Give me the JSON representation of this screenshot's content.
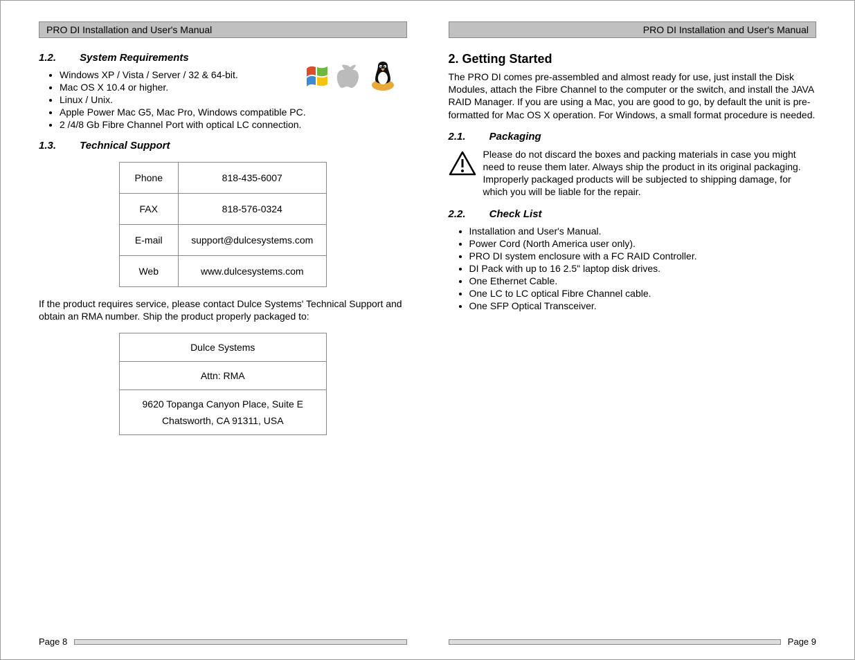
{
  "header": {
    "title": "PRO DI Installation and User's Manual"
  },
  "left": {
    "sec12": {
      "num": "1.2.",
      "title": "System Requirements"
    },
    "reqs": [
      "Windows XP / Vista / Server /  32 & 64-bit.",
      "Mac OS X 10.4 or higher.",
      "Linux / Unix.",
      "Apple Power Mac G5, Mac Pro, Windows compatible PC.",
      "2 /4/8 Gb Fibre Channel Port with optical LC connection."
    ],
    "sec13": {
      "num": "1.3.",
      "title": "Technical Support"
    },
    "support": {
      "phone_lbl": "Phone",
      "phone": "818-435-6007",
      "fax_lbl": "FAX",
      "fax": "818-576-0324",
      "email_lbl": "E-mail",
      "email": "support@dulcesystems.com",
      "web_lbl": "Web",
      "web": "www.dulcesystems.com"
    },
    "rma_text": "If the product requires service, please contact Dulce Systems' Technical Support and obtain an RMA number.  Ship the product properly packaged to:",
    "addr": {
      "company": "Dulce Systems",
      "attn": "Attn: RMA",
      "street": "9620 Topanga Canyon Place, Suite E",
      "city": "Chatsworth, CA  91311, USA"
    },
    "page": "Page 8"
  },
  "right": {
    "h2": "2. Getting Started",
    "intro": "The PRO DI comes pre-assembled and almost ready for use, just install the Disk Modules, attach the Fibre Channel to the computer or the switch, and install the JAVA RAID Manager.   If you are using a Mac, you are good to go, by default the unit is pre-formatted for Mac OS X operation.  For Windows, a small format procedure is needed.",
    "sec21": {
      "num": "2.1.",
      "title": "Packaging"
    },
    "pack_text": "Please do not discard the boxes and packing materials in case you might need to reuse them later.  Always ship the product in its original packaging.  Improperly packaged products will be subjected to shipping damage, for which you will be liable for the repair.",
    "sec22": {
      "num": "2.2.",
      "title": "Check List"
    },
    "checklist": [
      "Installation and User's Manual.",
      "Power Cord (North America user only).",
      "PRO DI system enclosure with a FC RAID Controller.",
      "DI Pack with up to 16 2.5\" laptop disk drives.",
      "One Ethernet Cable.",
      "One LC to LC optical Fibre Channel cable.",
      "One SFP Optical Transceiver."
    ],
    "page": "Page 9"
  }
}
